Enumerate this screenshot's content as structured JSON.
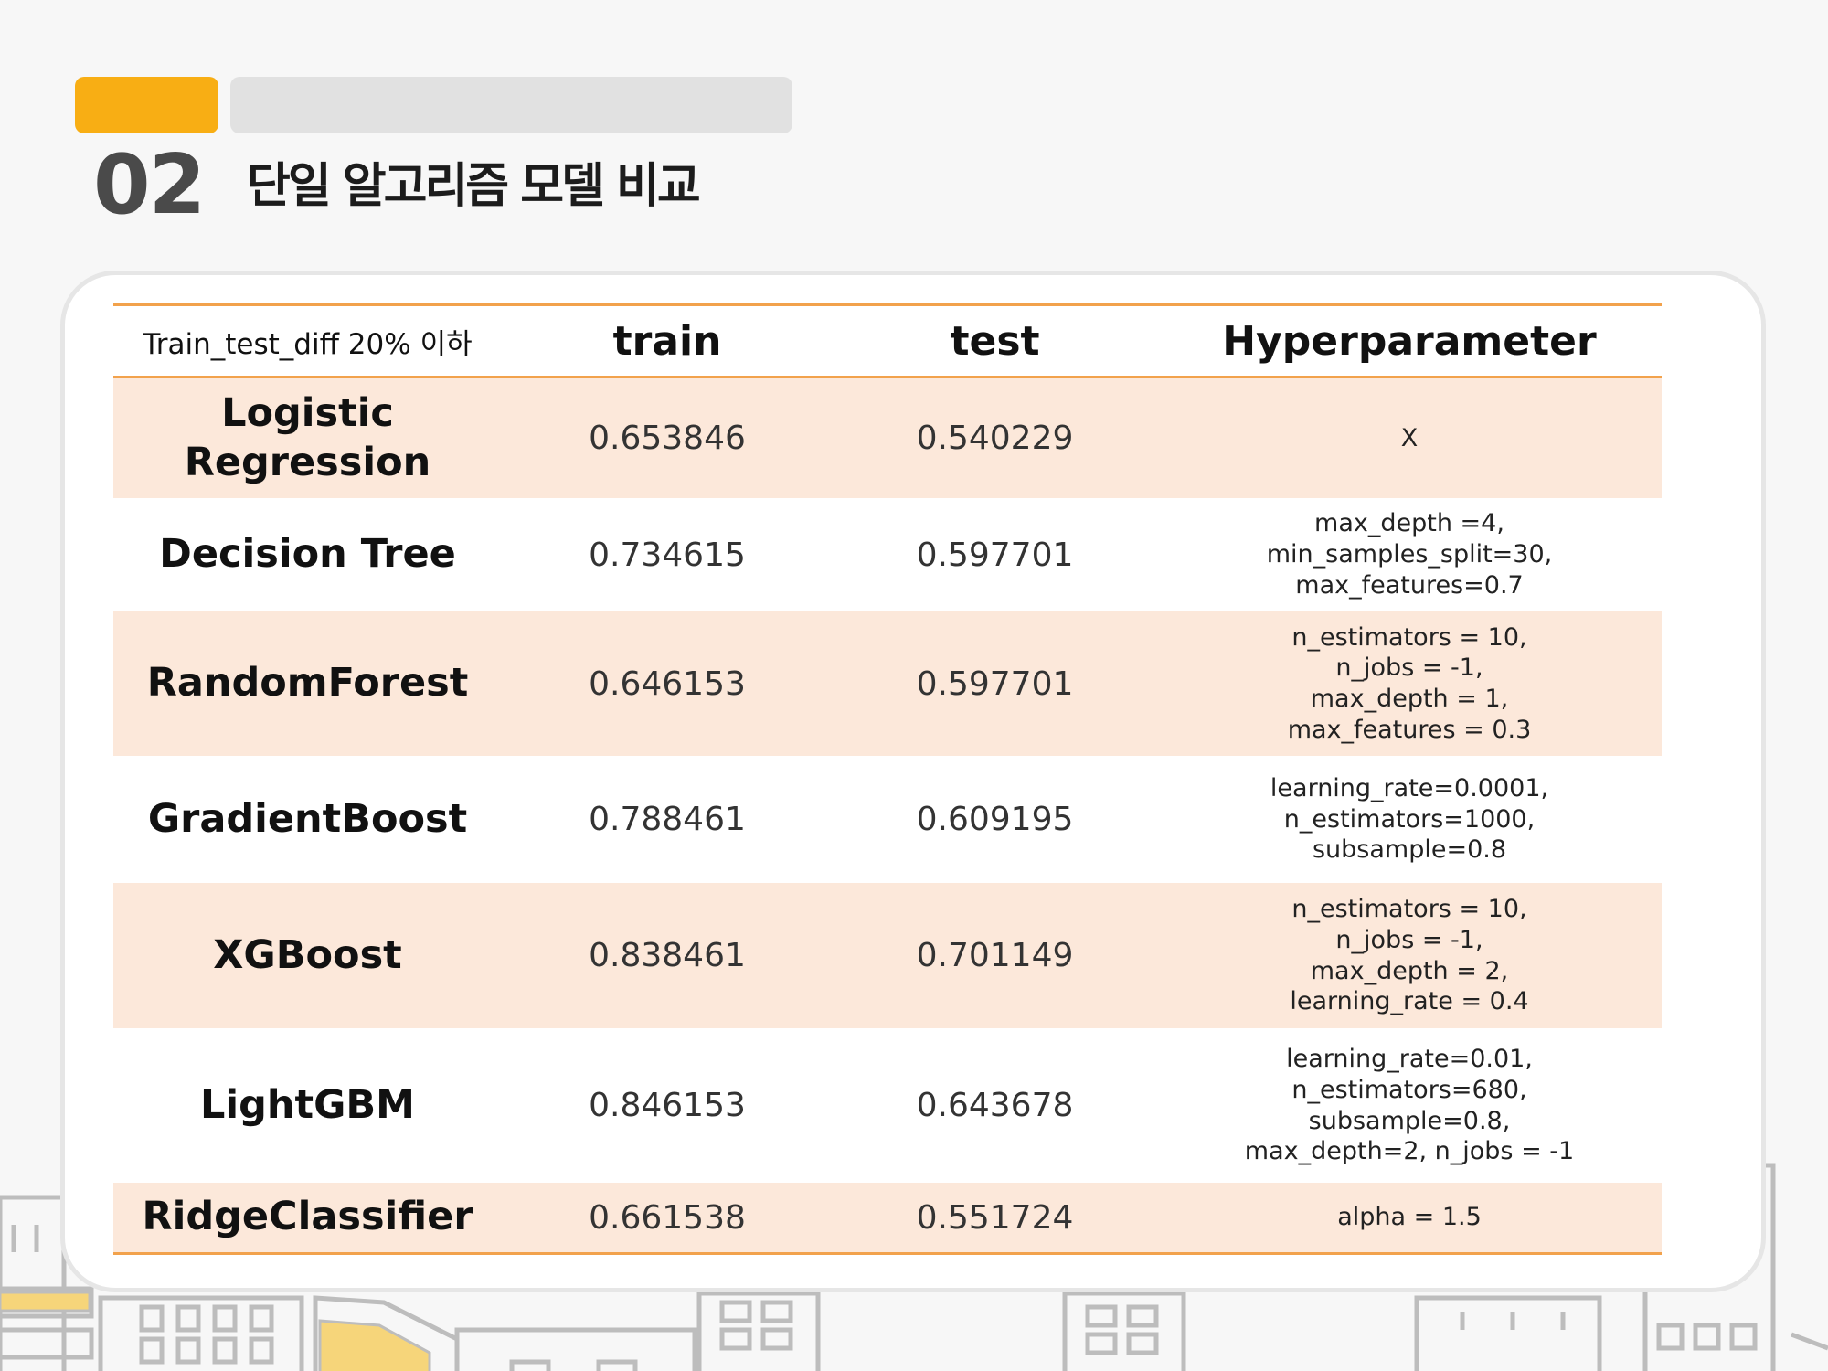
{
  "header": {
    "section_number": "02",
    "title": "단일 알고리즘 모델 비교"
  },
  "table": {
    "columns": [
      "Train_test_diff 20% 이하",
      "train",
      "test",
      "Hyperparameter"
    ],
    "rows": [
      {
        "model": "Logistic Regression",
        "train": "0.653846",
        "test": "0.540229",
        "hyperparameter": "X"
      },
      {
        "model": "Decision Tree",
        "train": "0.734615",
        "test": "0.597701",
        "hyperparameter": "max_depth =4,\nmin_samples_split=30,\nmax_features=0.7"
      },
      {
        "model": "RandomForest",
        "train": "0.646153",
        "test": "0.597701",
        "hyperparameter": "n_estimators = 10,\nn_jobs = -1,\nmax_depth = 1,\nmax_features = 0.3"
      },
      {
        "model": "GradientBoost",
        "train": "0.788461",
        "test": "0.609195",
        "hyperparameter": "learning_rate=0.0001,\nn_estimators=1000,\nsubsample=0.8"
      },
      {
        "model": "XGBoost",
        "train": "0.838461",
        "test": "0.701149",
        "hyperparameter": "n_estimators = 10,\nn_jobs = -1,\nmax_depth = 2,\nlearning_rate = 0.4"
      },
      {
        "model": "LightGBM",
        "train": "0.846153",
        "test": "0.643678",
        "hyperparameter": "learning_rate=0.01, n_estimators=680,\nsubsample=0.8,\nmax_depth=2, n_jobs = -1"
      },
      {
        "model": "RidgeClassifier",
        "train": "0.661538",
        "test": "0.551724",
        "hyperparameter": "alpha = 1.5"
      }
    ]
  },
  "colors": {
    "accent": "#f8ae14",
    "row_shade": "#fce8da",
    "rule": "#f2a24c"
  }
}
